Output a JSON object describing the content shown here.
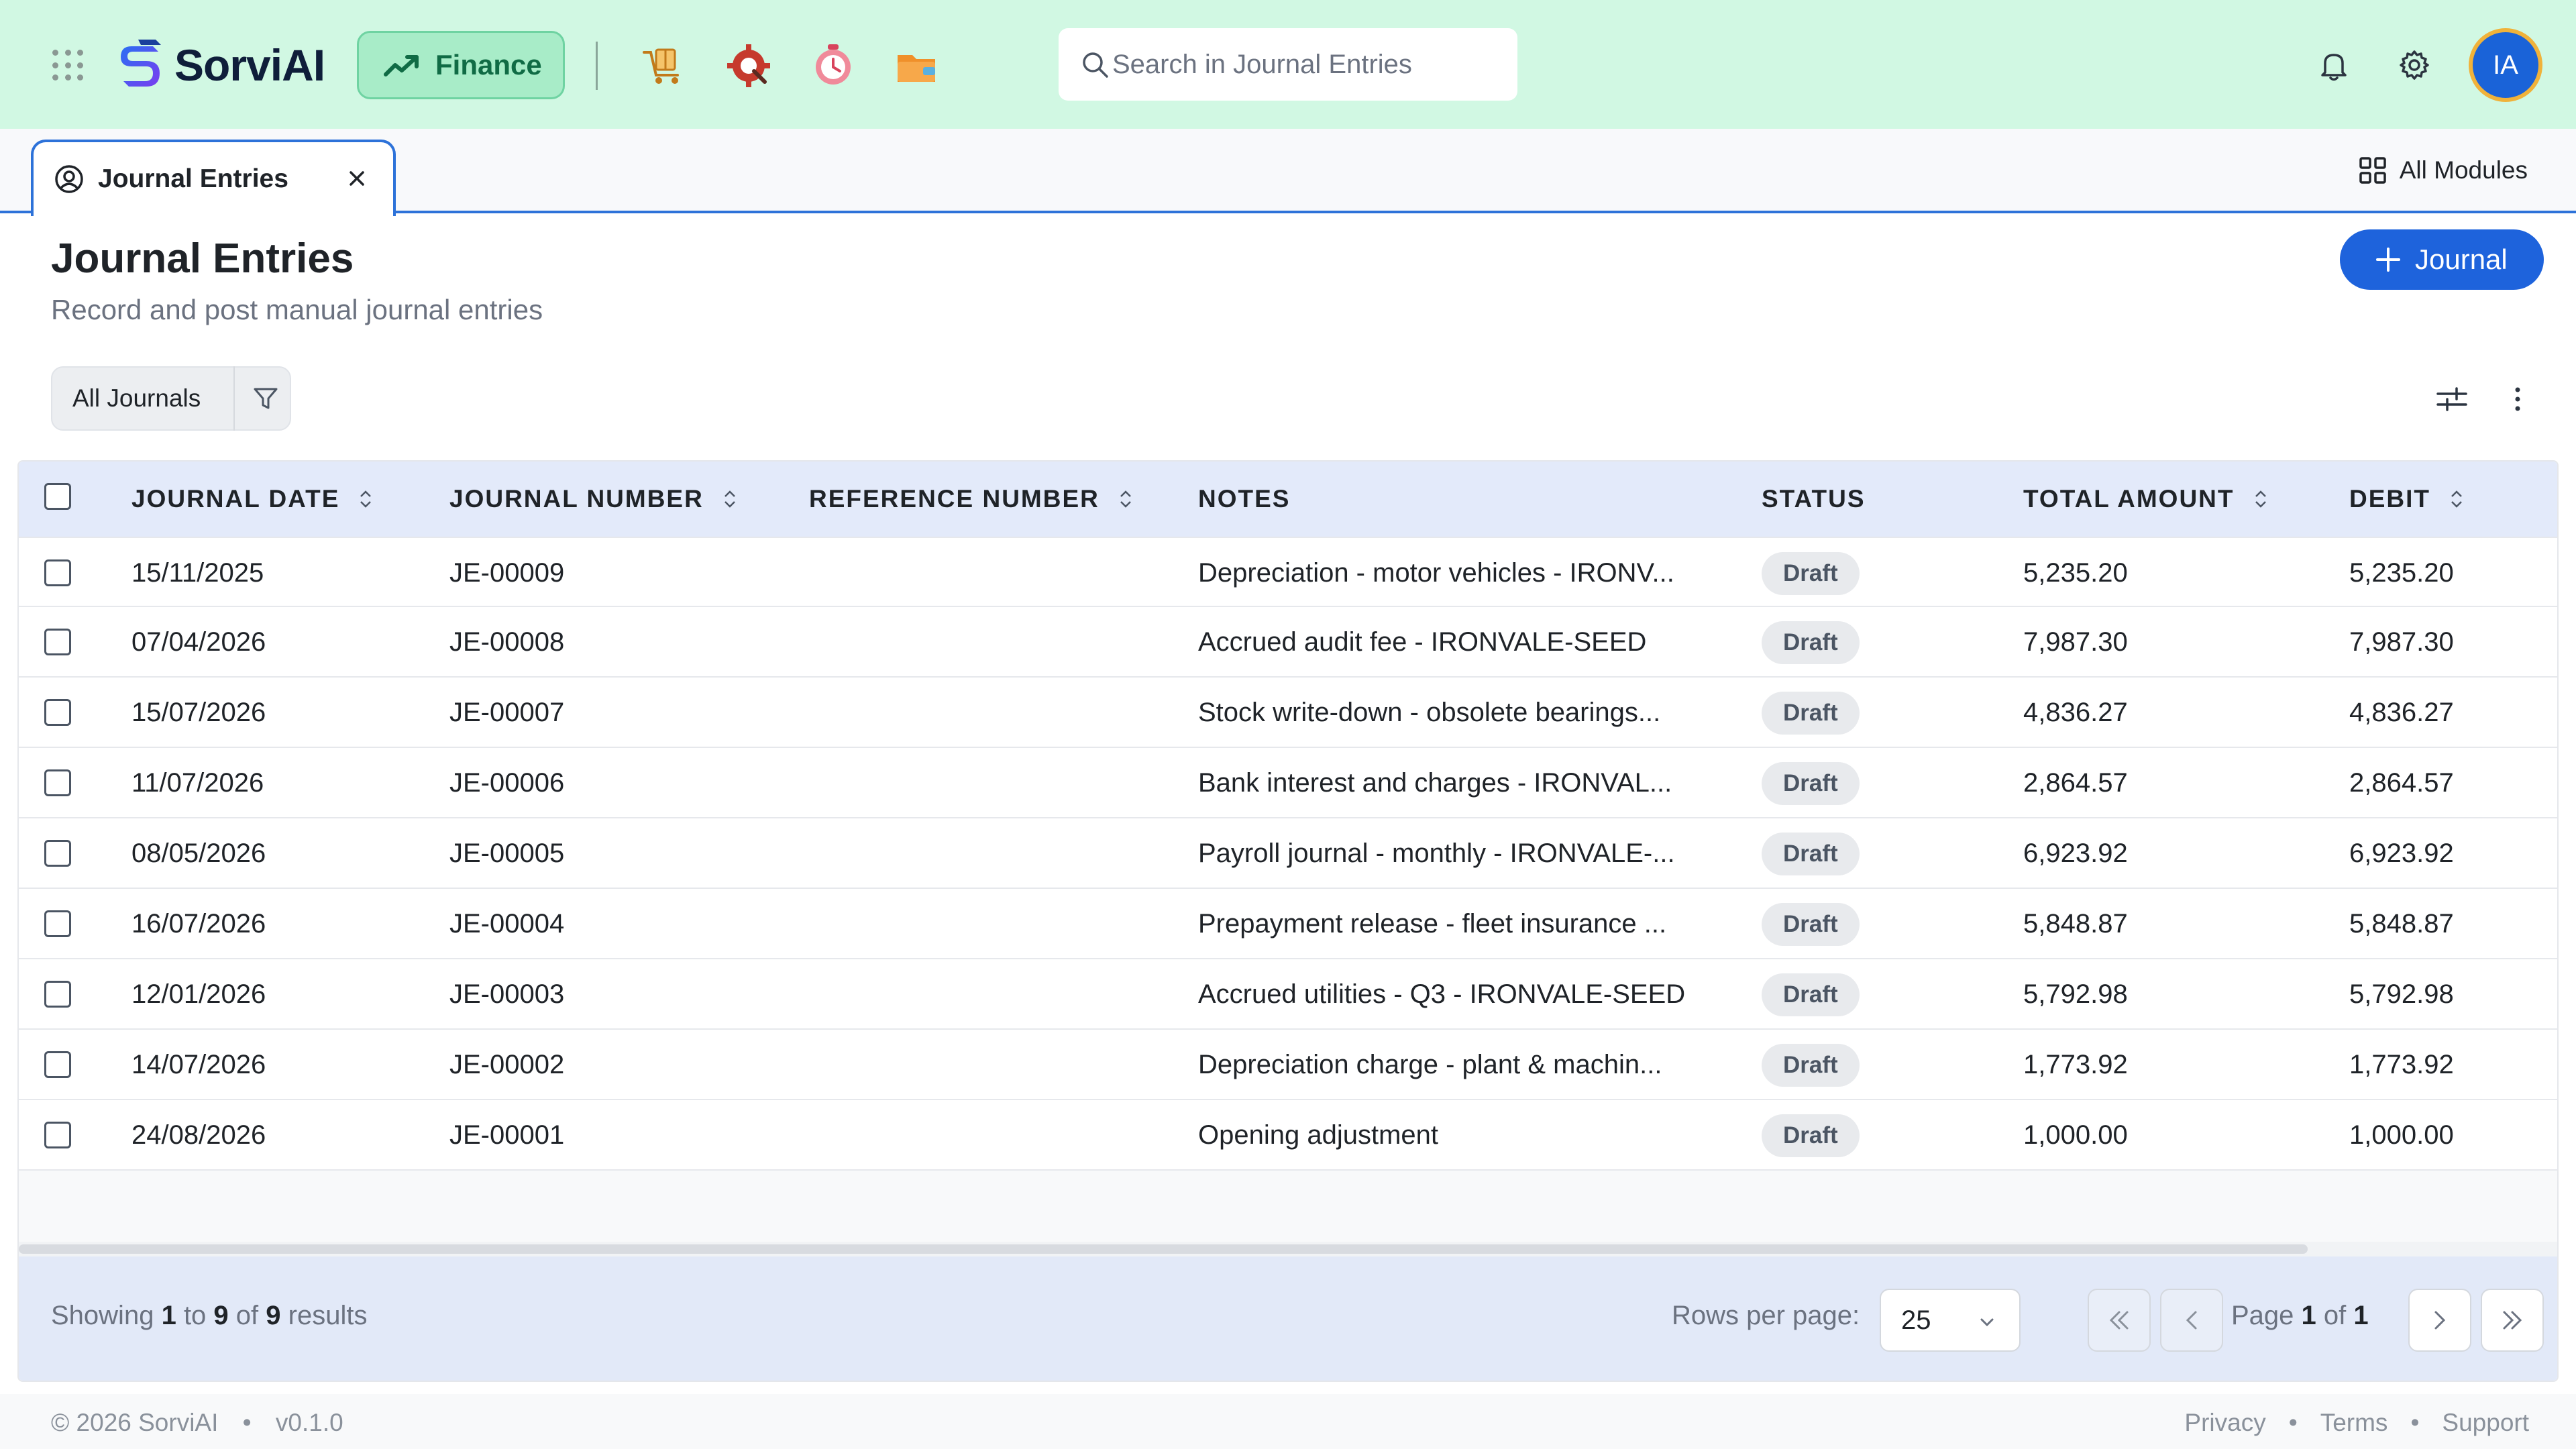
{
  "brand": {
    "name": "SorviAI",
    "accent": "#1e63dc",
    "topbar_bg": "#d1f8e3"
  },
  "topbar": {
    "module_label": "Finance",
    "app_icons": [
      "procurement-cart-icon",
      "service-gear-icon",
      "time-clock-icon",
      "wallet-folder-icon"
    ],
    "search_placeholder": "Search in Journal Entries",
    "avatar_initials": "IA"
  },
  "tabs": {
    "active_label": "Journal Entries",
    "all_modules_label": "All Modules"
  },
  "page": {
    "title": "Journal Entries",
    "subtitle": "Record and post manual journal entries",
    "primary_button": "Journal"
  },
  "filters": {
    "view_label": "All Journals"
  },
  "table": {
    "columns": [
      "JOURNAL DATE",
      "JOURNAL NUMBER",
      "REFERENCE NUMBER",
      "NOTES",
      "STATUS",
      "TOTAL AMOUNT",
      "DEBIT"
    ],
    "rows": [
      {
        "date": "15/11/2025",
        "number": "JE-00009",
        "reference": "",
        "notes": "Depreciation - motor vehicles - IRONV...",
        "status": "Draft",
        "total": "5,235.20",
        "debit": "5,235.20"
      },
      {
        "date": "07/04/2026",
        "number": "JE-00008",
        "reference": "",
        "notes": "Accrued audit fee - IRONVALE-SEED",
        "status": "Draft",
        "total": "7,987.30",
        "debit": "7,987.30"
      },
      {
        "date": "15/07/2026",
        "number": "JE-00007",
        "reference": "",
        "notes": "Stock write-down - obsolete bearings...",
        "status": "Draft",
        "total": "4,836.27",
        "debit": "4,836.27"
      },
      {
        "date": "11/07/2026",
        "number": "JE-00006",
        "reference": "",
        "notes": "Bank interest and charges - IRONVAL...",
        "status": "Draft",
        "total": "2,864.57",
        "debit": "2,864.57"
      },
      {
        "date": "08/05/2026",
        "number": "JE-00005",
        "reference": "",
        "notes": "Payroll journal - monthly - IRONVALE-...",
        "status": "Draft",
        "total": "6,923.92",
        "debit": "6,923.92"
      },
      {
        "date": "16/07/2026",
        "number": "JE-00004",
        "reference": "",
        "notes": "Prepayment release - fleet insurance ...",
        "status": "Draft",
        "total": "5,848.87",
        "debit": "5,848.87"
      },
      {
        "date": "12/01/2026",
        "number": "JE-00003",
        "reference": "",
        "notes": "Accrued utilities - Q3 - IRONVALE-SEED",
        "status": "Draft",
        "total": "5,792.98",
        "debit": "5,792.98"
      },
      {
        "date": "14/07/2026",
        "number": "JE-00002",
        "reference": "",
        "notes": "Depreciation charge - plant & machin...",
        "status": "Draft",
        "total": "1,773.92",
        "debit": "1,773.92"
      },
      {
        "date": "24/08/2026",
        "number": "JE-00001",
        "reference": "",
        "notes": "Opening adjustment",
        "status": "Draft",
        "total": "1,000.00",
        "debit": "1,000.00"
      }
    ]
  },
  "pagination": {
    "showing_prefix": "Showing",
    "from": "1",
    "to_word": "to",
    "to": "9",
    "of_word": "of",
    "total": "9",
    "results_word": "results",
    "rows_per_page_label": "Rows per page:",
    "rows_per_page": "25",
    "page_word": "Page",
    "current_page": "1",
    "page_of_word": "of",
    "page_count": "1"
  },
  "footer": {
    "copyright": "© 2026 SorviAI",
    "version": "v0.1.0",
    "links": [
      "Privacy",
      "Terms",
      "Support"
    ]
  }
}
